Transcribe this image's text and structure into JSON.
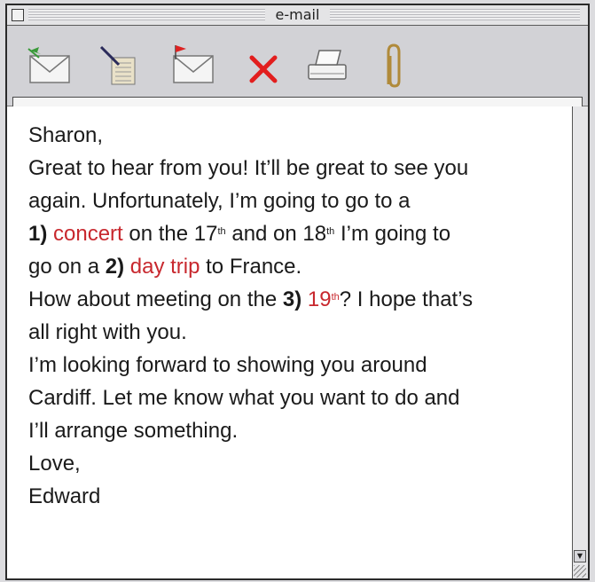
{
  "window": {
    "title": "e-mail"
  },
  "toolbar": {
    "buttons": [
      {
        "icon": "send-mail-icon"
      },
      {
        "icon": "compose-note-icon"
      },
      {
        "icon": "flagged-mail-icon"
      },
      {
        "icon": "delete-x-icon"
      },
      {
        "icon": "print-icon"
      },
      {
        "icon": "attachment-paperclip-icon"
      }
    ]
  },
  "message": {
    "greeting": "Sharon,",
    "l1": "Great to hear from you! It’ll be great to see you",
    "l2": "again. Unfortunately, I’m going to go to a",
    "l3_num": "1)",
    "l3_word": "concert",
    "l3_a": "on the 17",
    "l3_sup1": "th",
    "l3_b": "and on 18",
    "l3_sup2": "th",
    "l3_c": "I’m going to",
    "l4_a": "go on a",
    "l4_num": "2)",
    "l4_word": "day trip",
    "l4_b": "to France.",
    "l5_a": "How about meeting on the",
    "l5_num": "3)",
    "l5_word": "19",
    "l5_sup": "th",
    "l5_b": "? I hope that’s",
    "l6": "all right with you.",
    "l7": "I’m looking forward to showing you around",
    "l8": "Cardiff. Let me know what you want to do and",
    "l9": "I’ll arrange something.",
    "closing": "Love,",
    "signature": "Edward"
  },
  "colors": {
    "highlight": "#c8282e"
  }
}
